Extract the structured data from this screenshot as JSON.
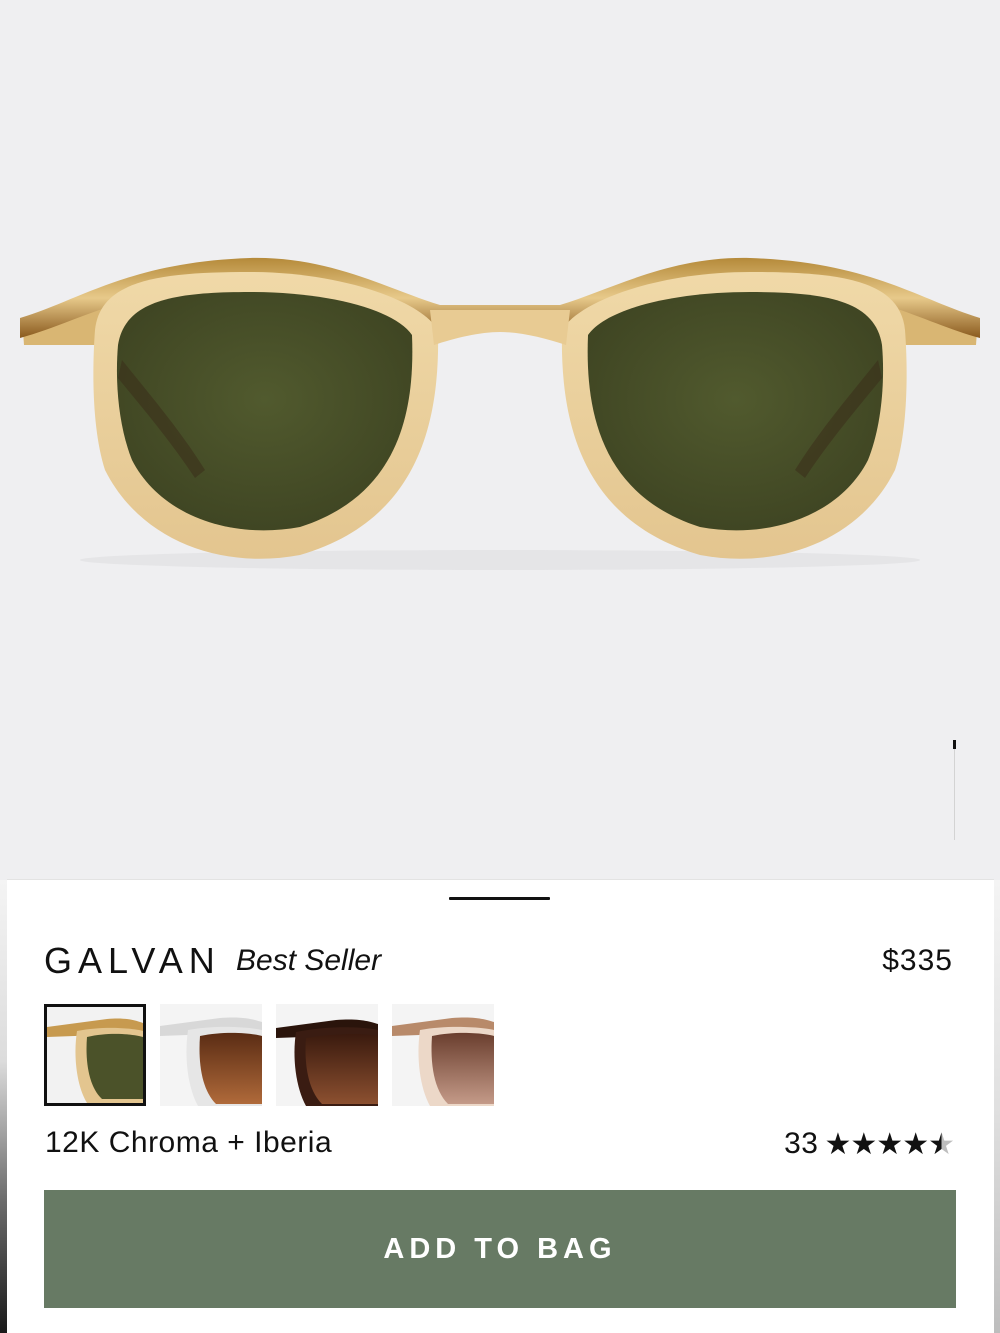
{
  "product": {
    "name": "GALVAN",
    "badge": "Best Seller",
    "price": "$335",
    "color_name": "12K Chroma + Iberia",
    "review_count": "33",
    "rating": 4.5,
    "rating_max": 5
  },
  "hero_image": {
    "icon": "sunglasses-product-image",
    "frame_color": "#e3c58f",
    "lens_color": "#4b5229",
    "carousel_index_fraction": 0.1
  },
  "swatches": [
    {
      "name": "swatch-1",
      "frame_color": "#e3c58f",
      "lens_color": "#4b5229",
      "selected": true
    },
    {
      "name": "swatch-2",
      "frame_color": "#e6e6e6",
      "lens_color": "#8a4a24",
      "selected": false
    },
    {
      "name": "swatch-3",
      "frame_color": "#3a1c12",
      "lens_color": "#6e3a1f",
      "selected": false
    },
    {
      "name": "swatch-4",
      "frame_color": "#ecd8c8",
      "lens_color": "#a06b55",
      "selected": false
    }
  ],
  "actions": {
    "add_to_bag": "ADD TO BAG"
  },
  "colors": {
    "button_bg": "#677a64",
    "text": "#111111",
    "background": "#efeff1"
  }
}
